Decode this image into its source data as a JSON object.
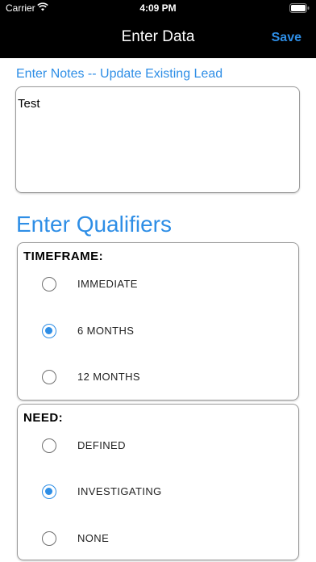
{
  "status_bar": {
    "carrier": "Carrier",
    "time": "4:09 PM"
  },
  "nav": {
    "title": "Enter Data",
    "save_label": "Save"
  },
  "notes": {
    "label": "Enter Notes -- Update Existing Lead",
    "value": "Test"
  },
  "qualifiers": {
    "heading": "Enter Qualifiers",
    "timeframe": {
      "title": "TIMEFRAME:",
      "options": [
        {
          "label": "IMMEDIATE",
          "selected": false
        },
        {
          "label": "6 MONTHS",
          "selected": true
        },
        {
          "label": "12 MONTHS",
          "selected": false
        }
      ]
    },
    "need": {
      "title": "NEED:",
      "options": [
        {
          "label": "DEFINED",
          "selected": false
        },
        {
          "label": "INVESTIGATING",
          "selected": true
        },
        {
          "label": "NONE",
          "selected": false
        }
      ]
    }
  },
  "colors": {
    "accent": "#2e8ee6",
    "header_bg": "#000000"
  }
}
